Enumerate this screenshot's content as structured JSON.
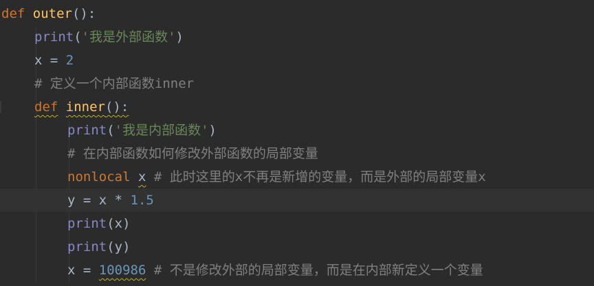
{
  "lines": [
    {
      "kw": "def",
      "name": "outer",
      "punct": "():"
    },
    {
      "builtin": "print",
      "open": "(",
      "str": "'我是外部函数'",
      "close": ")"
    },
    {
      "var": "x",
      "op": " = ",
      "num": "2"
    },
    {
      "comment": "# 定义一个内部函数inner"
    },
    {
      "kw": "def",
      "name": "inner",
      "punct": "():"
    },
    {
      "builtin": "print",
      "open": "(",
      "str": "'我是内部函数'",
      "close": ")"
    },
    {
      "comment": "# 在内部函数如何修改外部函数的局部变量"
    },
    {
      "kw": "nonlocal",
      "var": "x",
      "comment": "# 此时这里的x不再是新增的变量，而是外部的局部变量x"
    },
    {
      "var": "y",
      "op": " = x * ",
      "num": "1.5"
    },
    {
      "builtin": "print",
      "open": "(",
      "arg": "x",
      "close": ")"
    },
    {
      "builtin": "print",
      "open": "(",
      "arg": "y",
      "close": ")"
    },
    {
      "var": "x",
      "op": " = ",
      "num": "100986",
      "comment": "# 不是修改外部的局部变量，而是在内部新定义一个变量"
    }
  ],
  "colors": {
    "background": "#2b2b2b",
    "current_line": "#323232",
    "keyword": "#cc7832",
    "function_name": "#ffc66d",
    "builtin": "#8888c6",
    "string": "#6a8759",
    "number": "#6897bb",
    "comment": "#808080",
    "default": "#a9b7c6"
  }
}
